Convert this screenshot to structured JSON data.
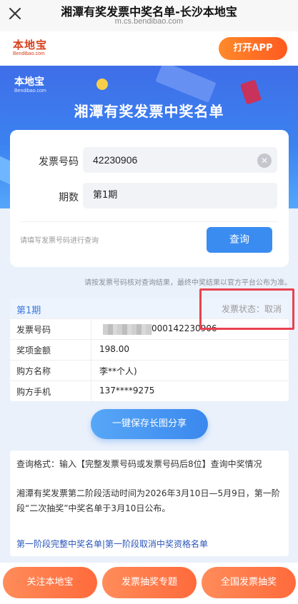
{
  "browser": {
    "title": "湘潭有奖发票中奖名单-长沙本地宝",
    "url": "m.cs.bendibao.com"
  },
  "site": {
    "logo_cn": "本地宝",
    "logo_en": "Bendibao.com",
    "open_app": "打开APP"
  },
  "hero": {
    "logo_cn": "本地宝",
    "logo_en": "Bendibao.com",
    "title": "湘潭有奖发票中奖名单"
  },
  "search": {
    "invoice_label": "发票号码",
    "invoice_value": "42230906",
    "period_label": "期数",
    "period_value": "第1期",
    "hint": "请填写发票号码进行查询",
    "button": "查询"
  },
  "disclaimer": "请按发票号码核对查询结果，最终中奖结果以官方平台公布为准。",
  "result": {
    "period": "第1期",
    "status": "发票状态：取消",
    "rows": [
      {
        "key": "发票号码",
        "value": "000142230906"
      },
      {
        "key": "奖项金额",
        "value": "198.00"
      },
      {
        "key": "购方名称",
        "value": "李**个人)"
      },
      {
        "key": "购方手机",
        "value": "137****9275"
      }
    ]
  },
  "share_button": "一键保存长图分享",
  "info": {
    "format": "查询格式：输入【完整发票号码或发票号码后8位】查询中奖情况",
    "notice": "湘潭有奖发票第二阶段活动时间为2026年3月10日—5月9日，第一阶段“二次抽奖”中奖名单于3月10日公布。",
    "links": "第一阶段完整中奖名单|第一阶段取消中奖资格名单"
  },
  "bottom_buttons": [
    "关注本地宝",
    "发票抽奖专题",
    "全国发票抽奖"
  ],
  "colors": {
    "accent_blue": "#3a8cf0",
    "orange": "#ff6a3b",
    "highlight_red": "#e8424f"
  }
}
